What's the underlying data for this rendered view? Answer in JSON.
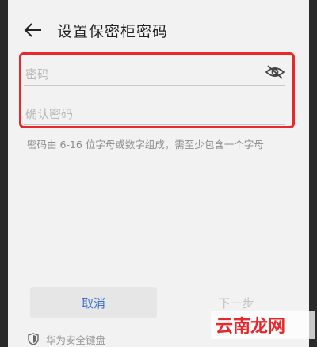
{
  "header": {
    "title": "设置保密柜密码",
    "back_icon": "arrow-left-icon"
  },
  "form": {
    "password_placeholder": "密码",
    "confirm_placeholder": "确认密码",
    "visibility_icon": "eye-off-icon",
    "hint": "密码由 6-16 位字母或数字组成，需至少包含一个字母",
    "highlight_color": "#e8282b"
  },
  "buttons": {
    "cancel_label": "取消",
    "next_label": "下一步"
  },
  "keyboard": {
    "label": "华为安全键盘",
    "icon": "shield-icon"
  },
  "watermark": {
    "text": "云南龙网"
  },
  "colors": {
    "accent": "#3a6fc9",
    "disabled_text": "#c3c3c3",
    "background": "#f2f2f2"
  }
}
